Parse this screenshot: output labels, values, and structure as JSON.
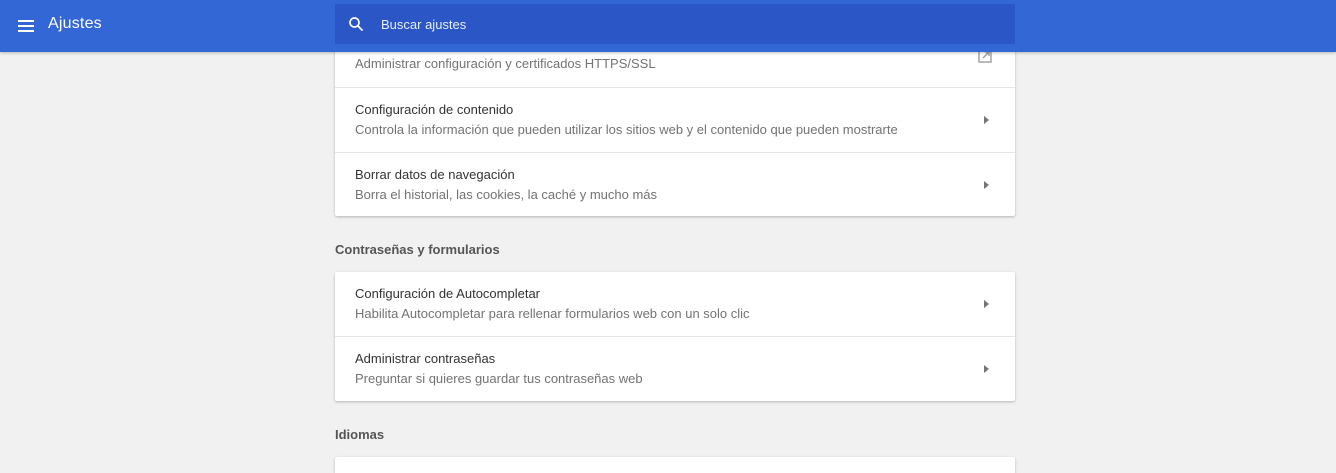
{
  "header": {
    "title": "Ajustes",
    "menu_icon": "hamburger-menu-icon",
    "search": {
      "placeholder": "Buscar ajustes",
      "value": "",
      "icon": "search-icon"
    },
    "color": "#3367d6"
  },
  "privacy_card": {
    "rows": [
      {
        "title": "",
        "description": "Administrar configuración y certificados HTTPS/SSL",
        "icon": "external-link-icon"
      },
      {
        "title": "Configuración de contenido",
        "description": "Controla la información que pueden utilizar los sitios web y el contenido que pueden mostrarte",
        "icon": "arrow-right-icon"
      },
      {
        "title": "Borrar datos de navegación",
        "description": "Borra el historial, las cookies, la caché y mucho más",
        "icon": "arrow-right-icon"
      }
    ]
  },
  "passwords_section": {
    "title": "Contraseñas y formularios",
    "rows": [
      {
        "title": "Configuración de Autocompletar",
        "description": "Habilita Autocompletar para rellenar formularios web con un solo clic",
        "icon": "arrow-right-icon"
      },
      {
        "title": "Administrar contraseñas",
        "description": "Preguntar si quieres guardar tus contraseñas web",
        "icon": "arrow-right-icon"
      }
    ]
  },
  "languages_section": {
    "title": "Idiomas"
  }
}
